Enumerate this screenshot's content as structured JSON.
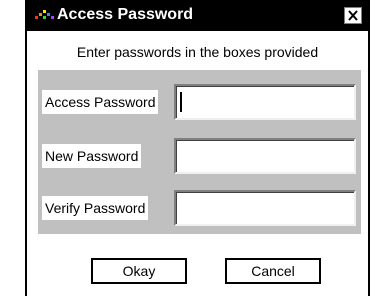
{
  "window": {
    "title": "Access Password",
    "close_glyph": "×",
    "app_icon": "colored-dots-app-icon",
    "close_icon": "close-x-icon"
  },
  "dialog": {
    "instruction": "Enter passwords in the boxes provided",
    "fields": [
      {
        "label": "Access Password",
        "value": "",
        "focused": true
      },
      {
        "label": "New Password",
        "value": "",
        "focused": false
      },
      {
        "label": "Verify Password",
        "value": "",
        "focused": false
      }
    ],
    "buttons": {
      "okay": "Okay",
      "cancel": "Cancel"
    }
  },
  "colors": {
    "titlebar": "#000000",
    "panel": "#c0c0c0"
  }
}
